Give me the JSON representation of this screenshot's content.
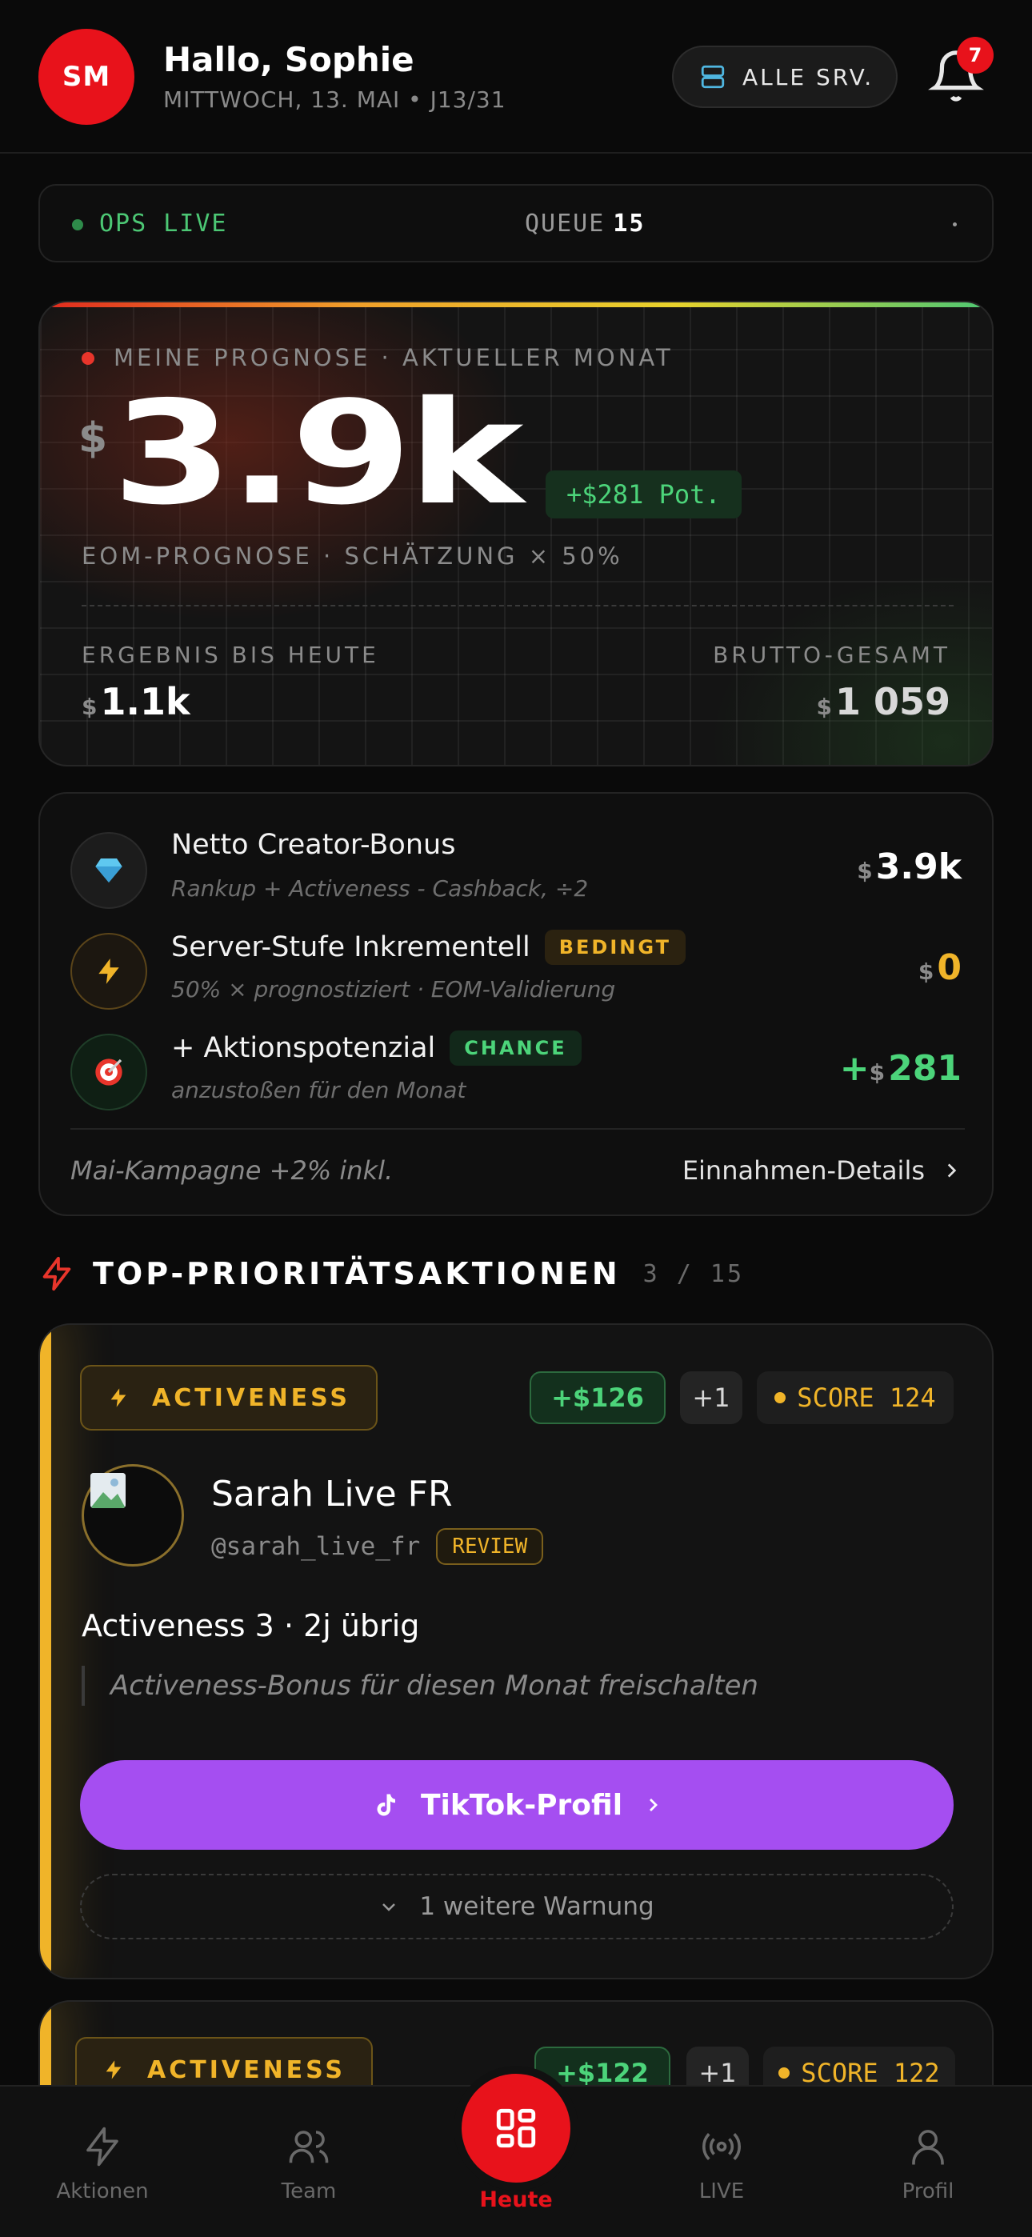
{
  "header": {
    "avatar_initials": "SM",
    "greeting": "Hallo, Sophie",
    "date": "MITTWOCH, 13. MAI • J13/31",
    "server_button": "ALLE SRV.",
    "notification_count": "7"
  },
  "ops": {
    "status": "OPS LIVE",
    "queue_label": "QUEUE",
    "queue_value": "15"
  },
  "forecast": {
    "label": "MEINE PROGNOSE · AKTUELLER MONAT",
    "currency": "$",
    "value": "3.9k",
    "potential": "+$281 Pot.",
    "subtitle": "EOM-PROGNOSE · SCHÄTZUNG × 50%",
    "result_label": "ERGEBNIS BIS HEUTE",
    "result_value": "1.1k",
    "gross_label": "BRUTTO-GESAMT",
    "gross_value": "1 059"
  },
  "bonus": {
    "rows": [
      {
        "title": "Netto Creator-Bonus",
        "tag": "",
        "subtitle": "Rankup + Activeness - Cashback, ÷2",
        "currency": "$",
        "value": "3.9k",
        "icon": "diamond-icon"
      },
      {
        "title": "Server-Stufe Inkrementell",
        "tag": "BEDINGT",
        "subtitle": "50% × prognostiziert · EOM-Validierung",
        "currency": "$",
        "value": "0",
        "icon": "lightning-icon"
      },
      {
        "title": "+ Aktionspotenzial",
        "tag": "CHANCE",
        "subtitle": "anzustoßen für den Monat",
        "prefix": "+",
        "currency": "$",
        "value": "281",
        "icon": "target-icon"
      }
    ],
    "footer_note": "Mai-Kampagne +2% inkl.",
    "details_link": "Einnahmen-Details"
  },
  "section": {
    "title": "TOP-PRIORITÄTSAKTIONEN",
    "count": "3 / 15"
  },
  "actions": [
    {
      "tag": "ACTIVENESS",
      "money": "+$126",
      "plus": "+1",
      "score": "SCORE 124",
      "name": "Sarah Live FR",
      "handle": "@sarah_live_fr",
      "status": "REVIEW",
      "headline": "Activeness 3 · 2j übrig",
      "quote": "Activeness-Bonus für diesen Monat freischalten",
      "cta": "TikTok-Profil",
      "warning": "1 weitere Warnung"
    },
    {
      "tag": "ACTIVENESS",
      "money": "+$122",
      "plus": "+1",
      "score": "SCORE 122"
    }
  ],
  "nav": {
    "items": [
      "Aktionen",
      "Team",
      "Heute",
      "LIVE",
      "Profil"
    ]
  },
  "colors": {
    "brand_red": "#e8121b",
    "accent_green": "#4cd47a",
    "accent_amber": "#f0b429",
    "cta_purple": "#a54ef1"
  }
}
